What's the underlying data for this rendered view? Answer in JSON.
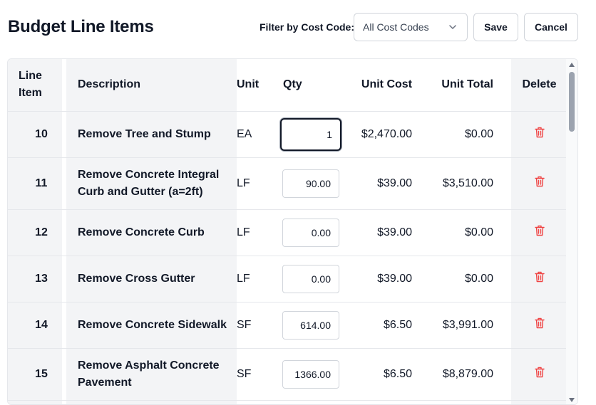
{
  "header": {
    "title": "Budget Line Items",
    "filter_label": "Filter by Cost Code:",
    "filter_value": "All Cost Codes",
    "save_label": "Save",
    "cancel_label": "Cancel"
  },
  "table": {
    "columns": {
      "line_item": "Line Item",
      "description": "Description",
      "unit": "Unit",
      "qty": "Qty",
      "unit_cost": "Unit Cost",
      "unit_total": "Unit Total",
      "delete": "Delete"
    },
    "rows": [
      {
        "line": "10",
        "description": "Remove Tree and Stump",
        "unit": "EA",
        "qty": "1",
        "unit_cost": "$2,470.00",
        "unit_total": "$0.00"
      },
      {
        "line": "11",
        "description": "Remove Concrete Integral Curb and Gutter (a=2ft)",
        "unit": "LF",
        "qty": "90.00",
        "unit_cost": "$39.00",
        "unit_total": "$3,510.00"
      },
      {
        "line": "12",
        "description": "Remove Concrete Curb",
        "unit": "LF",
        "qty": "0.00",
        "unit_cost": "$39.00",
        "unit_total": "$0.00"
      },
      {
        "line": "13",
        "description": "Remove Cross Gutter",
        "unit": "LF",
        "qty": "0.00",
        "unit_cost": "$39.00",
        "unit_total": "$0.00"
      },
      {
        "line": "14",
        "description": "Remove Concrete Sidewalk",
        "unit": "SF",
        "qty": "614.00",
        "unit_cost": "$6.50",
        "unit_total": "$3,991.00"
      },
      {
        "line": "15",
        "description": "Remove Asphalt Concrete Pavement",
        "unit": "SF",
        "qty": "1366.00",
        "unit_cost": "$6.50",
        "unit_total": "$8,879.00"
      }
    ]
  },
  "icons": {
    "delete": "trash-icon",
    "dropdown": "chevron-down-icon"
  },
  "colors": {
    "delete_icon": "#ef4444",
    "row_shade": "#f3f4f6"
  }
}
